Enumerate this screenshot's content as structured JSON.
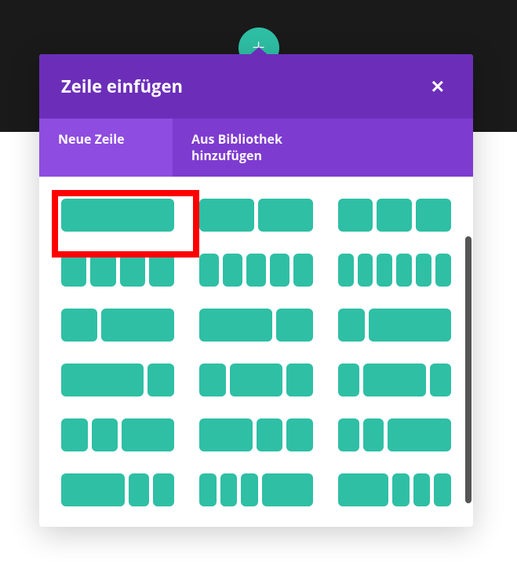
{
  "modal": {
    "title": "Zeile einfügen",
    "close_glyph": "✕",
    "tabs": {
      "new_row": "Neue Zeile",
      "from_library": "Aus Bibliothek hinzufügen"
    }
  },
  "add_button": {
    "glyph": "+"
  },
  "layouts": [
    {
      "name": "layout-1-col",
      "cols": [
        1
      ]
    },
    {
      "name": "layout-2-col",
      "cols": [
        1,
        1
      ]
    },
    {
      "name": "layout-3-col",
      "cols": [
        1,
        1,
        1
      ]
    },
    {
      "name": "layout-4-col",
      "cols": [
        1,
        1,
        1,
        1
      ]
    },
    {
      "name": "layout-5-col",
      "cols": [
        1,
        1,
        1,
        1,
        1
      ]
    },
    {
      "name": "layout-6-col",
      "cols": [
        1,
        1,
        1,
        1,
        1,
        1
      ]
    },
    {
      "name": "layout-1-3-2-3",
      "cols": [
        1,
        2
      ]
    },
    {
      "name": "layout-2-3-1-3",
      "cols": [
        2,
        1
      ]
    },
    {
      "name": "layout-1-4-3-4",
      "cols": [
        1,
        3
      ]
    },
    {
      "name": "layout-3-4-1-4",
      "cols": [
        3,
        1
      ]
    },
    {
      "name": "layout-1-4-1-2-1-4",
      "cols": [
        1,
        2,
        1
      ]
    },
    {
      "name": "layout-1-5-3-5-1-5",
      "cols": [
        1,
        3,
        1
      ]
    },
    {
      "name": "layout-1-4-1-4-1-2",
      "cols": [
        1,
        1,
        2
      ]
    },
    {
      "name": "layout-1-2-1-4-1-4",
      "cols": [
        2,
        1,
        1
      ]
    },
    {
      "name": "layout-1-5-1-5-3-5",
      "cols": [
        1,
        1,
        3
      ]
    },
    {
      "name": "layout-3-5-1-5-1-5",
      "cols": [
        3,
        1,
        1
      ]
    },
    {
      "name": "layout-1-6-1-6-1-6-1-2",
      "cols": [
        1,
        1,
        1,
        3
      ]
    },
    {
      "name": "layout-1-2-1-6-1-6-1-6",
      "cols": [
        3,
        1,
        1,
        1
      ]
    }
  ],
  "highlight_index": 0,
  "colors": {
    "teal": "#2ebfa5",
    "purple_header": "#6c2eb9",
    "purple_tabs": "#7e3bd0",
    "purple_tab_active": "#8e4ce0",
    "highlight": "#f00"
  }
}
